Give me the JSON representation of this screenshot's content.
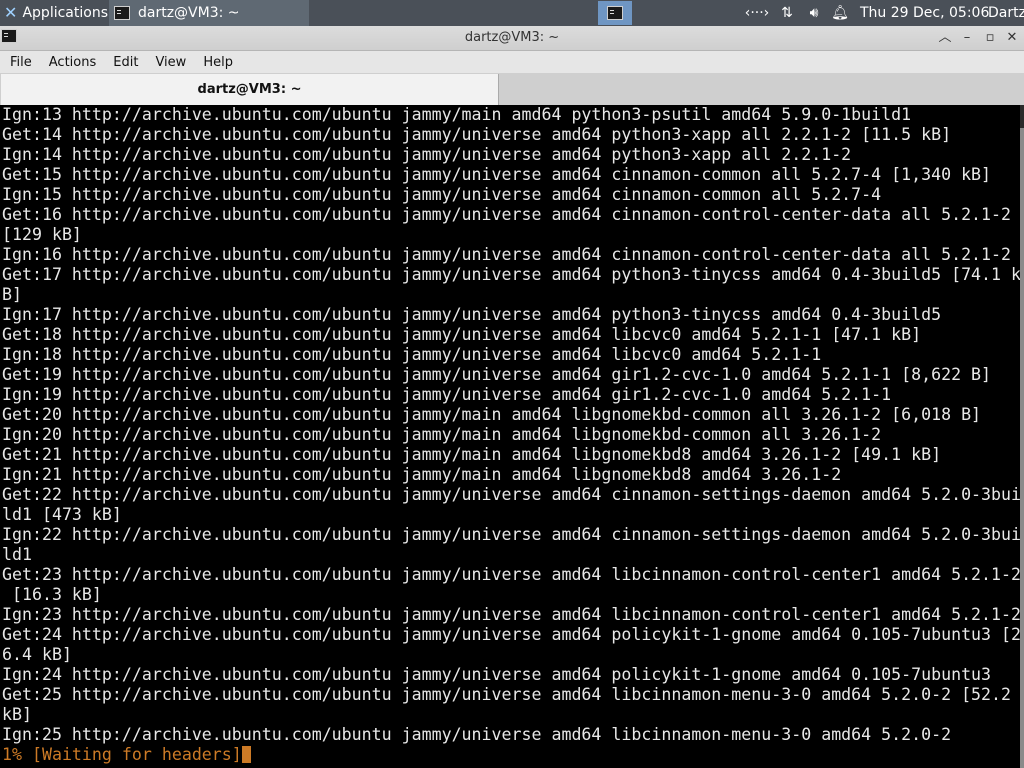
{
  "panel": {
    "applications_label": "Applications",
    "task_title": "dartz@VM3: ~",
    "clock": "Thu 29 Dec, 05:06",
    "user": "Dartz",
    "tray_icons": [
      "code-icon",
      "network-icon",
      "volume-icon",
      "notification-bell-icon"
    ]
  },
  "window": {
    "title": "dartz@VM3: ~",
    "controls": [
      "minimize",
      "maximize",
      "close"
    ]
  },
  "menu": [
    "File",
    "Actions",
    "Edit",
    "View",
    "Help"
  ],
  "tab": {
    "label": "dartz@VM3: ~"
  },
  "terminal": {
    "lines": [
      "Ign:13 http://archive.ubuntu.com/ubuntu jammy/main amd64 python3-psutil amd64 5.9.0-1build1",
      "Get:14 http://archive.ubuntu.com/ubuntu jammy/universe amd64 python3-xapp all 2.2.1-2 [11.5 kB]",
      "Ign:14 http://archive.ubuntu.com/ubuntu jammy/universe amd64 python3-xapp all 2.2.1-2",
      "Get:15 http://archive.ubuntu.com/ubuntu jammy/universe amd64 cinnamon-common all 5.2.7-4 [1,340 kB]",
      "Ign:15 http://archive.ubuntu.com/ubuntu jammy/universe amd64 cinnamon-common all 5.2.7-4",
      "Get:16 http://archive.ubuntu.com/ubuntu jammy/universe amd64 cinnamon-control-center-data all 5.2.1-2",
      "[129 kB]",
      "Ign:16 http://archive.ubuntu.com/ubuntu jammy/universe amd64 cinnamon-control-center-data all 5.2.1-2",
      "Get:17 http://archive.ubuntu.com/ubuntu jammy/universe amd64 python3-tinycss amd64 0.4-3build5 [74.1 k",
      "B]",
      "Ign:17 http://archive.ubuntu.com/ubuntu jammy/universe amd64 python3-tinycss amd64 0.4-3build5",
      "Get:18 http://archive.ubuntu.com/ubuntu jammy/universe amd64 libcvc0 amd64 5.2.1-1 [47.1 kB]",
      "Ign:18 http://archive.ubuntu.com/ubuntu jammy/universe amd64 libcvc0 amd64 5.2.1-1",
      "Get:19 http://archive.ubuntu.com/ubuntu jammy/universe amd64 gir1.2-cvc-1.0 amd64 5.2.1-1 [8,622 B]",
      "Ign:19 http://archive.ubuntu.com/ubuntu jammy/universe amd64 gir1.2-cvc-1.0 amd64 5.2.1-1",
      "Get:20 http://archive.ubuntu.com/ubuntu jammy/main amd64 libgnomekbd-common all 3.26.1-2 [6,018 B]",
      "Ign:20 http://archive.ubuntu.com/ubuntu jammy/main amd64 libgnomekbd-common all 3.26.1-2",
      "Get:21 http://archive.ubuntu.com/ubuntu jammy/main amd64 libgnomekbd8 amd64 3.26.1-2 [49.1 kB]",
      "Ign:21 http://archive.ubuntu.com/ubuntu jammy/main amd64 libgnomekbd8 amd64 3.26.1-2",
      "Get:22 http://archive.ubuntu.com/ubuntu jammy/universe amd64 cinnamon-settings-daemon amd64 5.2.0-3bui",
      "ld1 [473 kB]",
      "Ign:22 http://archive.ubuntu.com/ubuntu jammy/universe amd64 cinnamon-settings-daemon amd64 5.2.0-3bui",
      "ld1",
      "Get:23 http://archive.ubuntu.com/ubuntu jammy/universe amd64 libcinnamon-control-center1 amd64 5.2.1-2",
      " [16.3 kB]",
      "Ign:23 http://archive.ubuntu.com/ubuntu jammy/universe amd64 libcinnamon-control-center1 amd64 5.2.1-2",
      "Get:24 http://archive.ubuntu.com/ubuntu jammy/universe amd64 policykit-1-gnome amd64 0.105-7ubuntu3 [2",
      "6.4 kB]",
      "Ign:24 http://archive.ubuntu.com/ubuntu jammy/universe amd64 policykit-1-gnome amd64 0.105-7ubuntu3",
      "Get:25 http://archive.ubuntu.com/ubuntu jammy/universe amd64 libcinnamon-menu-3-0 amd64 5.2.0-2 [52.2",
      "kB]",
      "Ign:25 http://archive.ubuntu.com/ubuntu jammy/universe amd64 libcinnamon-menu-3-0 amd64 5.2.0-2"
    ],
    "status_line": "1% [Waiting for headers]",
    "status_color": "#cc7a26"
  }
}
